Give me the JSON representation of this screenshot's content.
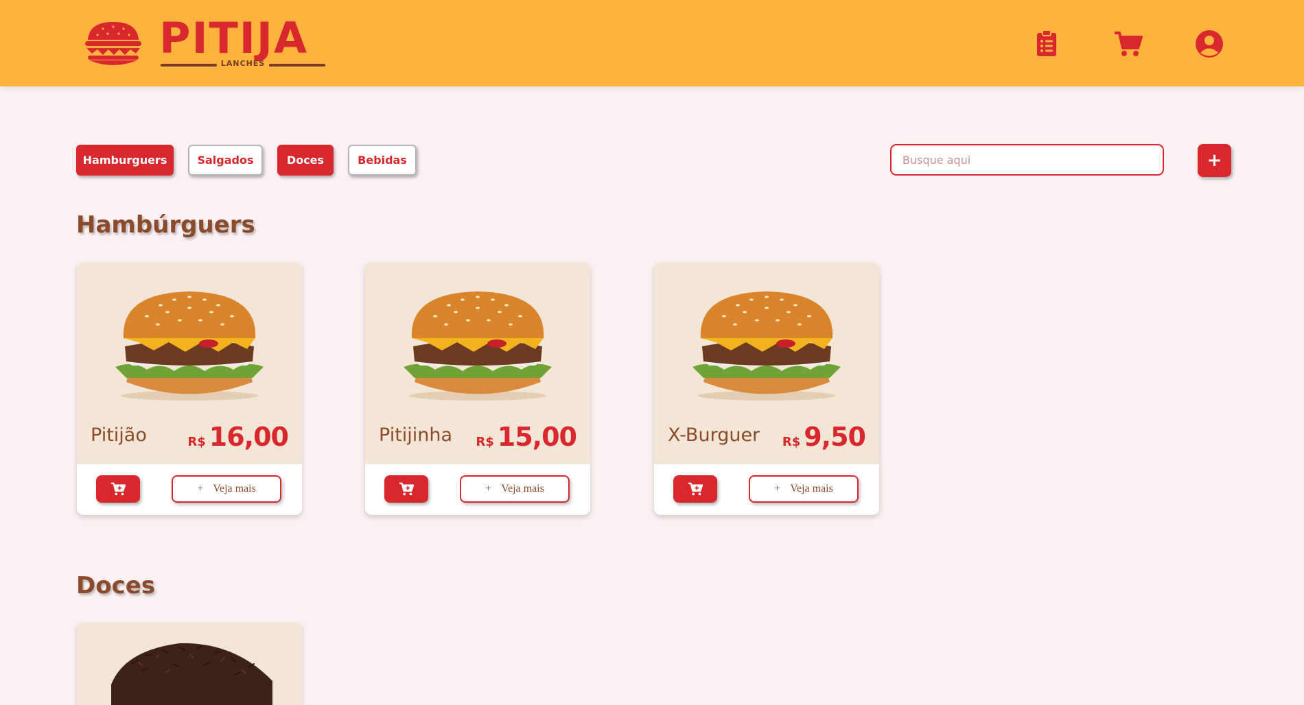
{
  "brand": {
    "name": "PITIJA",
    "subtitle": "LANCHES",
    "logo_icon": "burger-logo-icon"
  },
  "header": {
    "icons": [
      "clipboard-list-icon",
      "cart-icon",
      "user-circle-icon"
    ]
  },
  "categories": [
    {
      "label": "Hamburguers",
      "active": true
    },
    {
      "label": "Salgados",
      "active": false
    },
    {
      "label": "Doces",
      "active": true
    },
    {
      "label": "Bebidas",
      "active": false
    }
  ],
  "search": {
    "placeholder": "Busque aqui"
  },
  "add_button": {
    "label": "+"
  },
  "sections": [
    {
      "title": "Hambúrguers",
      "products": [
        {
          "name": "Pitijão",
          "currency": "R$",
          "price": "16,00",
          "more_label": "Veja mais",
          "more_icon": "+"
        },
        {
          "name": "Pitijinha",
          "currency": "R$",
          "price": "15,00",
          "more_label": "Veja mais",
          "more_icon": "+"
        },
        {
          "name": "X-Burguer",
          "currency": "R$",
          "price": "9,50",
          "more_label": "Veja mais",
          "more_icon": "+"
        }
      ]
    },
    {
      "title": "Doces",
      "products": []
    }
  ],
  "colors": {
    "header_bg": "#ffb33f",
    "primary_red": "#d9272e",
    "brown_text": "#8a4a2c",
    "card_bg": "#f4e6d7",
    "page_bg": "#fbf1f2"
  }
}
